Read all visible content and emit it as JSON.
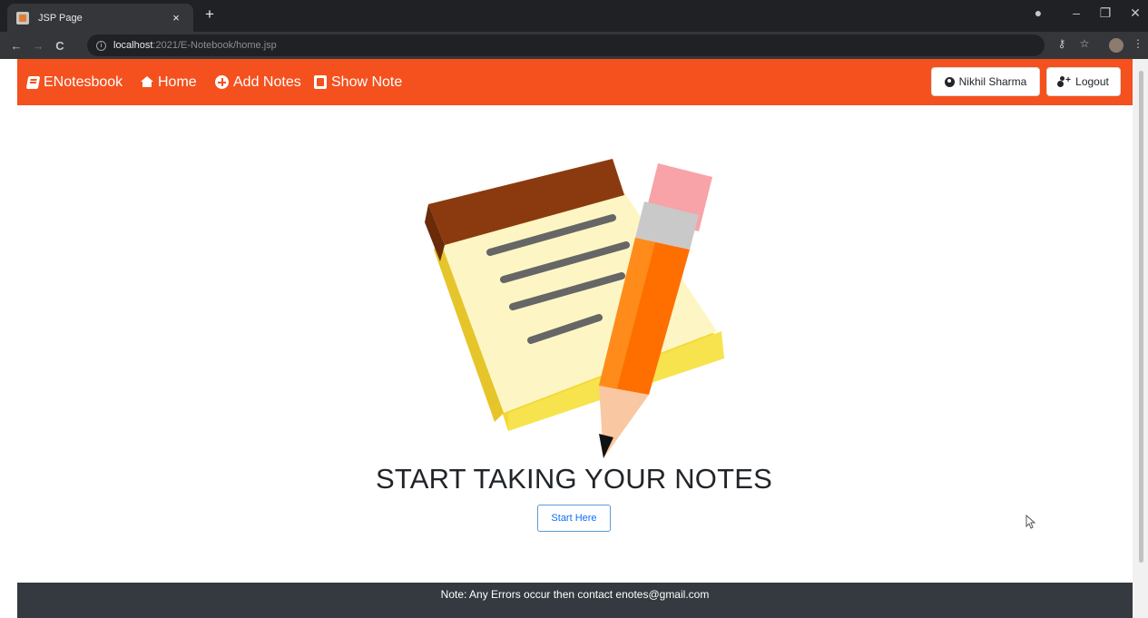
{
  "browser": {
    "tab_title": "JSP Page",
    "tab_close": "×",
    "new_tab": "+",
    "url_host": "localhost",
    "url_path": ":2021/E-Notebook/home.jsp",
    "win_minimize": "–",
    "win_restore": "❐",
    "win_close": "✕",
    "back": "←",
    "forward": "→",
    "reload": "C",
    "key_icon": "⚷",
    "star_icon": "☆",
    "menu_icon": "⋮"
  },
  "navbar": {
    "brand": "ENotesbook",
    "home": "Home",
    "add_notes": "Add Notes",
    "show_note": "Show Note",
    "user_name": "Nikhil Sharma",
    "logout": "Logout",
    "accent_color": "#f4511e"
  },
  "main": {
    "headline": "START TAKING YOUR NOTES",
    "start_button": "Start Here",
    "image": "notepad-with-pencil-illustration"
  },
  "footer": {
    "note": "Note: Any Errors occur then contact enotes@gmail.com",
    "background_color": "#343a40"
  }
}
